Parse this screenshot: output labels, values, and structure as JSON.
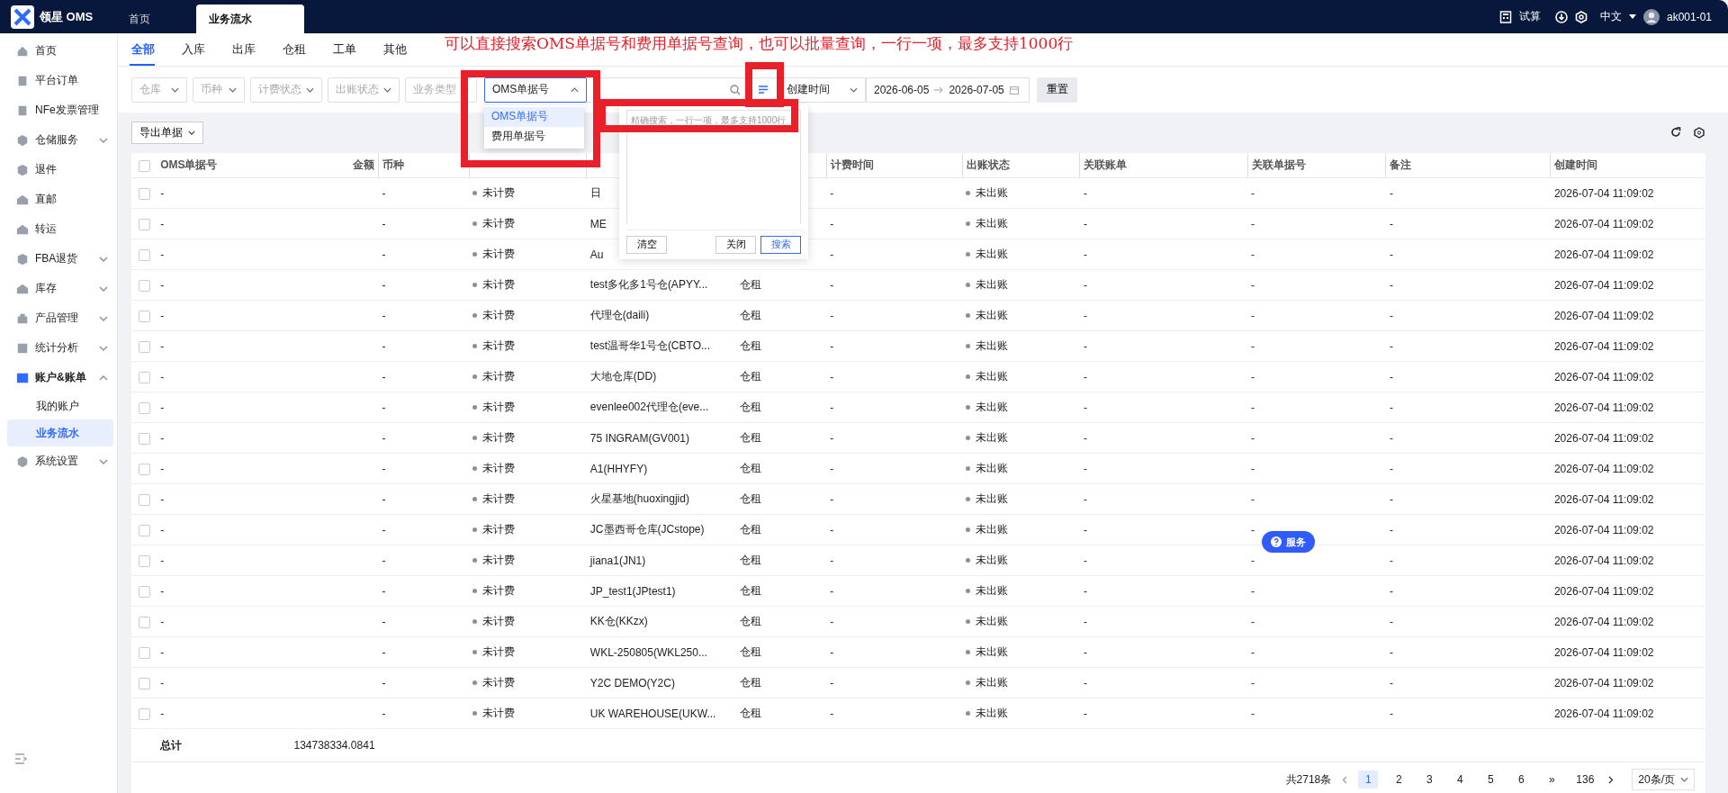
{
  "app": {
    "logo_text": "领星 OMS",
    "tabs": [
      {
        "label": "首页",
        "selected": false
      },
      {
        "label": "业务流水",
        "selected": true
      }
    ],
    "trial_calc": "试算",
    "language": "中文",
    "username": "ak001-01"
  },
  "sidebar": {
    "items": [
      {
        "label": "首页",
        "selected": false
      },
      {
        "label": "平台订单",
        "selected": false
      },
      {
        "label": "NFe发票管理",
        "selected": false
      },
      {
        "label": "仓储服务",
        "selected": false,
        "expanded": false
      },
      {
        "label": "退件",
        "selected": false
      },
      {
        "label": "直邮",
        "selected": false
      },
      {
        "label": "转运",
        "selected": false
      },
      {
        "label": "FBA退货",
        "selected": false,
        "expanded": false
      },
      {
        "label": "库存",
        "selected": false,
        "expanded": false
      },
      {
        "label": "产品管理",
        "selected": false,
        "expanded": false
      },
      {
        "label": "统计分析",
        "selected": false,
        "expanded": false
      },
      {
        "label": "账户&账单",
        "selected": false,
        "expanded": true,
        "children": [
          {
            "label": "我的账户",
            "selected": false
          },
          {
            "label": "业务流水",
            "selected": true
          }
        ]
      },
      {
        "label": "系统设置",
        "selected": false,
        "expanded": false
      }
    ]
  },
  "content_tabs": [
    {
      "label": "全部",
      "selected": true
    },
    {
      "label": "入库",
      "selected": false
    },
    {
      "label": "出库",
      "selected": false
    },
    {
      "label": "仓租",
      "selected": false
    },
    {
      "label": "工单",
      "selected": false
    },
    {
      "label": "其他",
      "selected": false
    }
  ],
  "annotation": "可以直接搜索OMS单据号和费用单据号查询，也可以批量查询，一行一项，最多支持1000行",
  "filters": {
    "selects": [
      {
        "placeholder": "仓库"
      },
      {
        "placeholder": "币种"
      },
      {
        "placeholder": "计费状态"
      },
      {
        "placeholder": "出账状态"
      },
      {
        "placeholder": "业务类型"
      }
    ],
    "search_type": {
      "value": "OMS单据号",
      "expanded": true,
      "options": [
        {
          "label": "OMS单据号",
          "selected": true
        },
        {
          "label": "费用单据号",
          "selected": false
        }
      ]
    },
    "time_type": {
      "value": "创建时间"
    },
    "date_start": "2026-06-05",
    "date_end": "2026-07-05",
    "reset_button": "重置"
  },
  "batch_search": {
    "open": true,
    "placeholder": "精确搜索，一行一项，最多支持1000行",
    "buttons": [
      "清空",
      "关闭",
      "搜索"
    ]
  },
  "toolbar": {
    "export_button": "导出单据"
  },
  "table": {
    "all_checked": false,
    "columns": {
      "oms": "OMS单据号",
      "amount": "金额",
      "currency": "币种",
      "billing_time": "计费时间",
      "account_status": "出账状态",
      "linked_bill": "关联账单",
      "linked_doc": "关联单据号",
      "remark": "备注",
      "created_at": "创建时间"
    },
    "rows": [
      {
        "checked": false,
        "oms": "-",
        "currency": "-",
        "billing_status": "未计费",
        "warehouse": "日",
        "billing_time": "-",
        "account_status": "未出账",
        "linked_bill": "-",
        "linked_doc": "-",
        "remark": "-",
        "created_at": "2026-07-04 11:09:02"
      },
      {
        "checked": false,
        "oms": "-",
        "currency": "-",
        "billing_status": "未计费",
        "warehouse": "ME",
        "billing_time": "-",
        "account_status": "未出账",
        "linked_bill": "-",
        "linked_doc": "-",
        "remark": "-",
        "created_at": "2026-07-04 11:09:02"
      },
      {
        "checked": false,
        "oms": "-",
        "currency": "-",
        "billing_status": "未计费",
        "warehouse": "Au",
        "billing_time": "-",
        "account_status": "未出账",
        "linked_bill": "-",
        "linked_doc": "-",
        "remark": "-",
        "created_at": "2026-07-04 11:09:02"
      },
      {
        "checked": false,
        "oms": "-",
        "currency": "-",
        "billing_status": "未计费",
        "warehouse": "test多化多1号仓(APYY...",
        "business_type": "仓租",
        "billing_time": "-",
        "account_status": "未出账",
        "linked_bill": "-",
        "linked_doc": "-",
        "remark": "-",
        "created_at": "2026-07-04 11:09:02"
      },
      {
        "checked": false,
        "oms": "-",
        "currency": "-",
        "billing_status": "未计费",
        "warehouse": "代理仓(daili)",
        "business_type": "仓租",
        "billing_time": "-",
        "account_status": "未出账",
        "linked_bill": "-",
        "linked_doc": "-",
        "remark": "-",
        "created_at": "2026-07-04 11:09:02"
      },
      {
        "checked": false,
        "oms": "-",
        "currency": "-",
        "billing_status": "未计费",
        "warehouse": "test温哥华1号仓(CBTO...",
        "business_type": "仓租",
        "billing_time": "-",
        "account_status": "未出账",
        "linked_bill": "-",
        "linked_doc": "-",
        "remark": "-",
        "created_at": "2026-07-04 11:09:02"
      },
      {
        "checked": false,
        "oms": "-",
        "currency": "-",
        "billing_status": "未计费",
        "warehouse": "大地仓库(DD)",
        "business_type": "仓租",
        "billing_time": "-",
        "account_status": "未出账",
        "linked_bill": "-",
        "linked_doc": "-",
        "remark": "-",
        "created_at": "2026-07-04 11:09:02"
      },
      {
        "checked": false,
        "oms": "-",
        "currency": "-",
        "billing_status": "未计费",
        "warehouse": "evenlee002代理仓(eve...",
        "business_type": "仓租",
        "billing_time": "-",
        "account_status": "未出账",
        "linked_bill": "-",
        "linked_doc": "-",
        "remark": "-",
        "created_at": "2026-07-04 11:09:02"
      },
      {
        "checked": false,
        "oms": "-",
        "currency": "-",
        "billing_status": "未计费",
        "warehouse": "75 INGRAM(GV001)",
        "business_type": "仓租",
        "billing_time": "-",
        "account_status": "未出账",
        "linked_bill": "-",
        "linked_doc": "-",
        "remark": "-",
        "created_at": "2026-07-04 11:09:02"
      },
      {
        "checked": false,
        "oms": "-",
        "currency": "-",
        "billing_status": "未计费",
        "warehouse": "A1(HHYFY)",
        "business_type": "仓租",
        "billing_time": "-",
        "account_status": "未出账",
        "linked_bill": "-",
        "linked_doc": "-",
        "remark": "-",
        "created_at": "2026-07-04 11:09:02"
      },
      {
        "checked": false,
        "oms": "-",
        "currency": "-",
        "billing_status": "未计费",
        "warehouse": "火星基地(huoxingjid)",
        "business_type": "仓租",
        "billing_time": "-",
        "account_status": "未出账",
        "linked_bill": "-",
        "linked_doc": "-",
        "remark": "-",
        "created_at": "2026-07-04 11:09:02"
      },
      {
        "checked": false,
        "oms": "-",
        "currency": "-",
        "billing_status": "未计费",
        "warehouse": "JC墨西哥仓库(JCstope)",
        "business_type": "仓租",
        "billing_time": "-",
        "account_status": "未出账",
        "linked_bill": "-",
        "linked_doc": "-",
        "remark": "-",
        "created_at": "2026-07-04 11:09:02"
      },
      {
        "checked": false,
        "oms": "-",
        "currency": "-",
        "billing_status": "未计费",
        "warehouse": "jiana1(JN1)",
        "business_type": "仓租",
        "billing_time": "-",
        "account_status": "未出账",
        "linked_bill": "-",
        "linked_doc": "-",
        "remark": "-",
        "created_at": "2026-07-04 11:09:02"
      },
      {
        "checked": false,
        "oms": "-",
        "currency": "-",
        "billing_status": "未计费",
        "warehouse": "JP_test1(JPtest1)",
        "business_type": "仓租",
        "billing_time": "-",
        "account_status": "未出账",
        "linked_bill": "-",
        "linked_doc": "-",
        "remark": "-",
        "created_at": "2026-07-04 11:09:02"
      },
      {
        "checked": false,
        "oms": "-",
        "currency": "-",
        "billing_status": "未计费",
        "warehouse": "KK仓(KKzx)",
        "business_type": "仓租",
        "billing_time": "-",
        "account_status": "未出账",
        "linked_bill": "-",
        "linked_doc": "-",
        "remark": "-",
        "created_at": "2026-07-04 11:09:02"
      },
      {
        "checked": false,
        "oms": "-",
        "currency": "-",
        "billing_status": "未计费",
        "warehouse": "WKL-250805(WKL250...",
        "business_type": "仓租",
        "billing_time": "-",
        "account_status": "未出账",
        "linked_bill": "-",
        "linked_doc": "-",
        "remark": "-",
        "created_at": "2026-07-04 11:09:02"
      },
      {
        "checked": false,
        "oms": "-",
        "currency": "-",
        "billing_status": "未计费",
        "warehouse": "Y2C DEMO(Y2C)",
        "business_type": "仓租",
        "billing_time": "-",
        "account_status": "未出账",
        "linked_bill": "-",
        "linked_doc": "-",
        "remark": "-",
        "created_at": "2026-07-04 11:09:02"
      },
      {
        "checked": false,
        "oms": "-",
        "currency": "-",
        "billing_status": "未计费",
        "warehouse": "UK WAREHOUSE(UKW...",
        "business_type": "仓租",
        "billing_time": "-",
        "account_status": "未出账",
        "linked_bill": "-",
        "linked_doc": "-",
        "remark": "-",
        "created_at": "2026-07-04 11:09:02"
      }
    ],
    "total_label": "总计",
    "total_amount": "134738334.0841"
  },
  "pagination": {
    "total": "共2718条",
    "pages": [
      {
        "label": "1",
        "selected": true
      },
      {
        "label": "2",
        "selected": false
      },
      {
        "label": "3",
        "selected": false
      },
      {
        "label": "4",
        "selected": false
      },
      {
        "label": "5",
        "selected": false
      },
      {
        "label": "6",
        "selected": false
      }
    ],
    "more": "»",
    "last_page": "136",
    "page_size": "20条/页"
  },
  "service_button": "服务"
}
